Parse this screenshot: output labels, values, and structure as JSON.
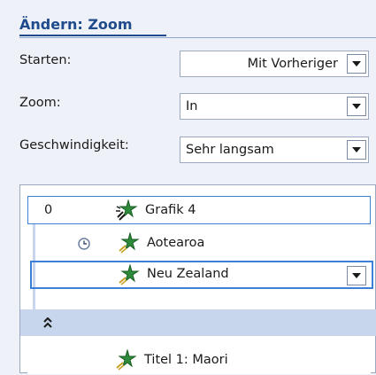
{
  "header": {
    "title": "Ändern: Zoom"
  },
  "start": {
    "label": "Starten:",
    "value": "Mit Vorheriger"
  },
  "zoom": {
    "label": "Zoom:",
    "value": "In"
  },
  "speed": {
    "label": "Geschwindigkeit:",
    "value": "Sehr langsam"
  },
  "animation_list": {
    "items": [
      {
        "number": "0",
        "label": "Grafik 4",
        "icon": "zoom-effect-icon"
      },
      {
        "number": "",
        "label": "Aotearoa",
        "icon": "zoom-effect-icon",
        "timing_icon": "clock-icon"
      },
      {
        "number": "",
        "label": "Neu Zealand",
        "icon": "zoom-effect-icon"
      },
      {
        "number": "",
        "label": "Titel 1: Maori",
        "icon": "zoom-effect-icon"
      }
    ],
    "collapse_icon": "double-chevron-up-icon"
  },
  "colors": {
    "accent": "#1f4a8c",
    "selection": "#3b7fd6",
    "group_bar": "#c7d6ec"
  }
}
